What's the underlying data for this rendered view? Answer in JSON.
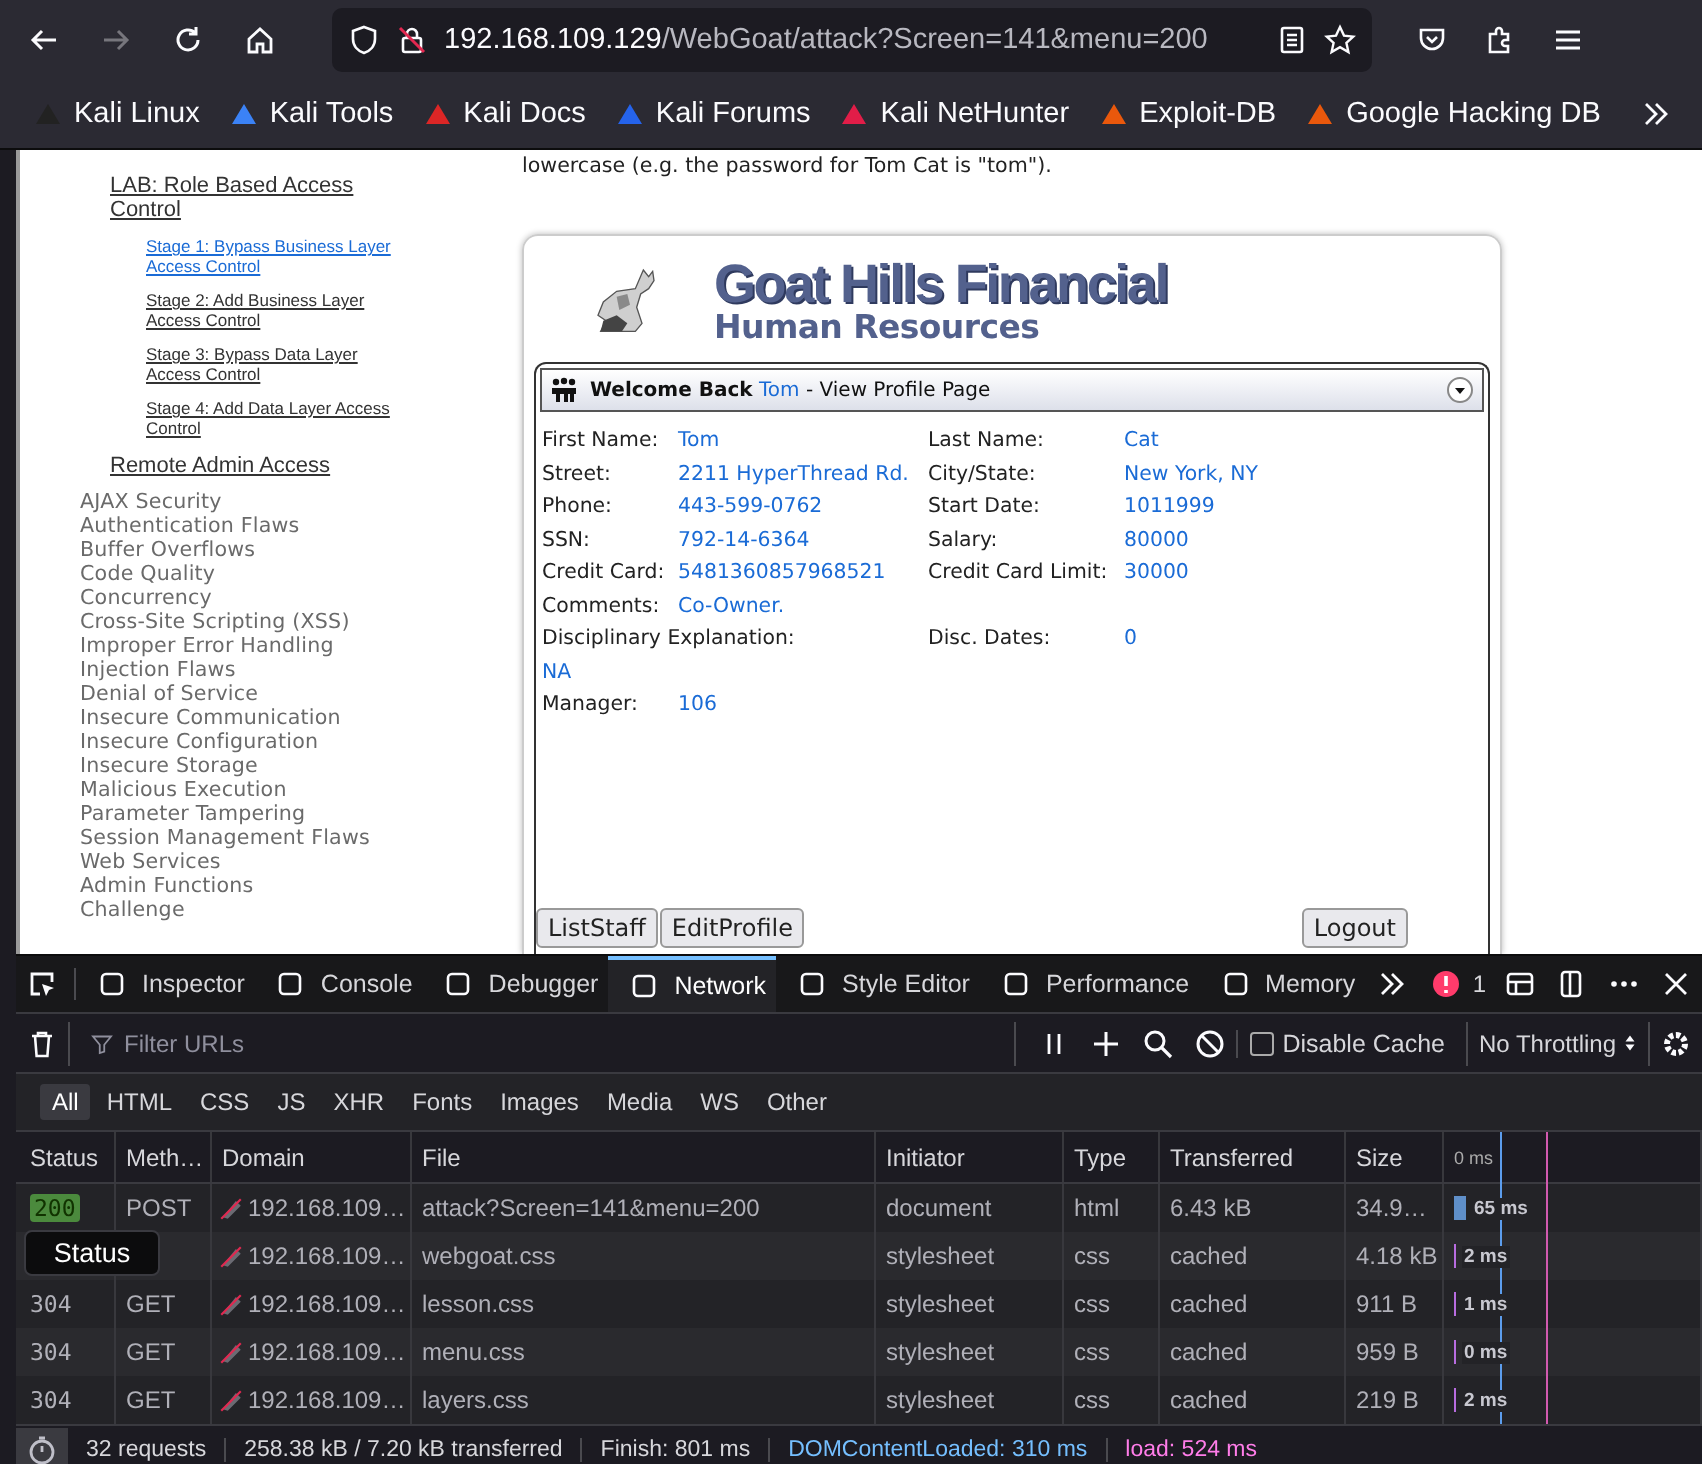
{
  "browser": {
    "url_host": "192.168.109.129",
    "url_path": "/WebGoat/attack?Screen=141&menu=200"
  },
  "bookmarks": [
    {
      "label": "Kali Linux",
      "color": "#222222"
    },
    {
      "label": "Kali Tools",
      "color": "#3b82f6"
    },
    {
      "label": "Kali Docs",
      "color": "#dc2626"
    },
    {
      "label": "Kali Forums",
      "color": "#2563eb"
    },
    {
      "label": "Kali NetHunter",
      "color": "#e11d48"
    },
    {
      "label": "Exploit-DB",
      "color": "#ea580c"
    },
    {
      "label": "Google Hacking DB",
      "color": "#ea580c"
    }
  ],
  "sidebar": {
    "lab": "LAB: Role Based Access Control",
    "stages": [
      {
        "label": "Stage 1: Bypass Business Layer Access Control",
        "selected": true
      },
      {
        "label": "Stage 2: Add Business Layer Access Control",
        "selected": false
      },
      {
        "label": "Stage 3: Bypass Data Layer Access Control",
        "selected": false
      },
      {
        "label": "Stage 4: Add Data Layer Access Control",
        "selected": false
      }
    ],
    "remote": "Remote Admin Access",
    "categories": [
      "AJAX Security",
      "Authentication Flaws",
      "Buffer Overflows",
      "Code Quality",
      "Concurrency",
      "Cross-Site Scripting (XSS)",
      "Improper Error Handling",
      "Injection Flaws",
      "Denial of Service",
      "Insecure Communication",
      "Insecure Configuration",
      "Insecure Storage",
      "Malicious Execution",
      "Parameter Tampering",
      "Session Management Flaws",
      "Web Services",
      "Admin Functions",
      "Challenge"
    ]
  },
  "intro": "lowercase (e.g. the password for Tom Cat is \"tom\").",
  "app": {
    "title": "Goat Hills Financial",
    "subtitle": "Human Resources",
    "header": {
      "prefix": "Welcome Back",
      "user": "Tom",
      "suffix": "- View Profile Page"
    },
    "rows": [
      {
        "left": {
          "label": "First Name:",
          "value": "Tom"
        },
        "right": {
          "label": "Last Name:",
          "value": "Cat"
        }
      },
      {
        "left": {
          "label": "Street:",
          "value": "2211 HyperThread Rd."
        },
        "right": {
          "label": "City/State:",
          "value": "New York, NY"
        }
      },
      {
        "left": {
          "label": "Phone:",
          "value": "443-599-0762"
        },
        "right": {
          "label": "Start Date:",
          "value": "1011999"
        }
      },
      {
        "left": {
          "label": "SSN:",
          "value": "792-14-6364"
        },
        "right": {
          "label": "Salary:",
          "value": "80000"
        }
      },
      {
        "left": {
          "label": "Credit Card:",
          "value": "5481360857968521"
        },
        "right": {
          "label": "Credit Card Limit:",
          "value": "30000"
        }
      },
      {
        "left": {
          "label": "Comments:",
          "value": "Co-Owner."
        }
      },
      {
        "left": {
          "label": "Disciplinary Explanation:",
          "value": "NA",
          "kind": "stacked"
        },
        "right": {
          "label": "Disc. Dates:",
          "value": "0"
        }
      },
      {
        "left": {
          "label": "Manager:",
          "value": "106"
        }
      }
    ],
    "buttons": [
      "ListStaff",
      "EditProfile"
    ],
    "logout": "Logout"
  },
  "devtools": {
    "tabs": [
      {
        "label": "Inspector",
        "selected": false
      },
      {
        "label": "Console",
        "selected": false
      },
      {
        "label": "Debugger",
        "selected": false
      },
      {
        "label": "Network",
        "selected": true
      },
      {
        "label": "Style Editor",
        "selected": false
      },
      {
        "label": "Performance",
        "selected": false
      },
      {
        "label": "Memory",
        "selected": false
      }
    ],
    "error_count": "1",
    "filter": {
      "placeholder": "Filter URLs"
    },
    "disable_cache": {
      "label": "Disable Cache",
      "checked": false
    },
    "throttling": "No Throttling",
    "types": [
      {
        "label": "All",
        "selected": true
      },
      {
        "label": "HTML",
        "selected": false
      },
      {
        "label": "CSS",
        "selected": false
      },
      {
        "label": "JS",
        "selected": false
      },
      {
        "label": "XHR",
        "selected": false
      },
      {
        "label": "Fonts",
        "selected": false
      },
      {
        "label": "Images",
        "selected": false
      },
      {
        "label": "Media",
        "selected": false
      },
      {
        "label": "WS",
        "selected": false
      },
      {
        "label": "Other",
        "selected": false
      }
    ],
    "columns": [
      "Status",
      "Meth…",
      "Domain",
      "File",
      "Initiator",
      "Type",
      "Transferred",
      "Size",
      "0 ms"
    ],
    "rows": [
      {
        "status": "200",
        "badge": true,
        "method": "POST",
        "domain": "192.168.109…",
        "file": "attack?Screen=141&menu=200",
        "initiator": "document",
        "type": "html",
        "transferred": "6.43 kB",
        "size": "34.9…",
        "timing": "65 ms"
      },
      {
        "domain": "192.168.109…",
        "file": "webgoat.css",
        "initiator": "stylesheet",
        "type": "css",
        "transferred": "cached",
        "size": "4.18 kB",
        "timing": "2 ms"
      },
      {
        "status": "304",
        "badge": false,
        "method": "GET",
        "domain": "192.168.109…",
        "file": "lesson.css",
        "initiator": "stylesheet",
        "type": "css",
        "transferred": "cached",
        "size": "911 B",
        "timing": "1 ms"
      },
      {
        "status": "304",
        "badge": false,
        "method": "GET",
        "domain": "192.168.109…",
        "file": "menu.css",
        "initiator": "stylesheet",
        "type": "css",
        "transferred": "cached",
        "size": "959 B",
        "timing": "0 ms"
      },
      {
        "status": "304",
        "badge": false,
        "method": "GET",
        "domain": "192.168.109…",
        "file": "layers.css",
        "initiator": "stylesheet",
        "type": "css",
        "transferred": "cached",
        "size": "219 B",
        "timing": "2 ms"
      }
    ],
    "tooltip": "Status",
    "summary": {
      "requests": "32 requests",
      "transferred": "258.38 kB / 7.20 kB transferred",
      "finish": "Finish: 801 ms",
      "dom": "DOMContentLoaded: 310 ms",
      "load": "load: 524 ms"
    }
  }
}
